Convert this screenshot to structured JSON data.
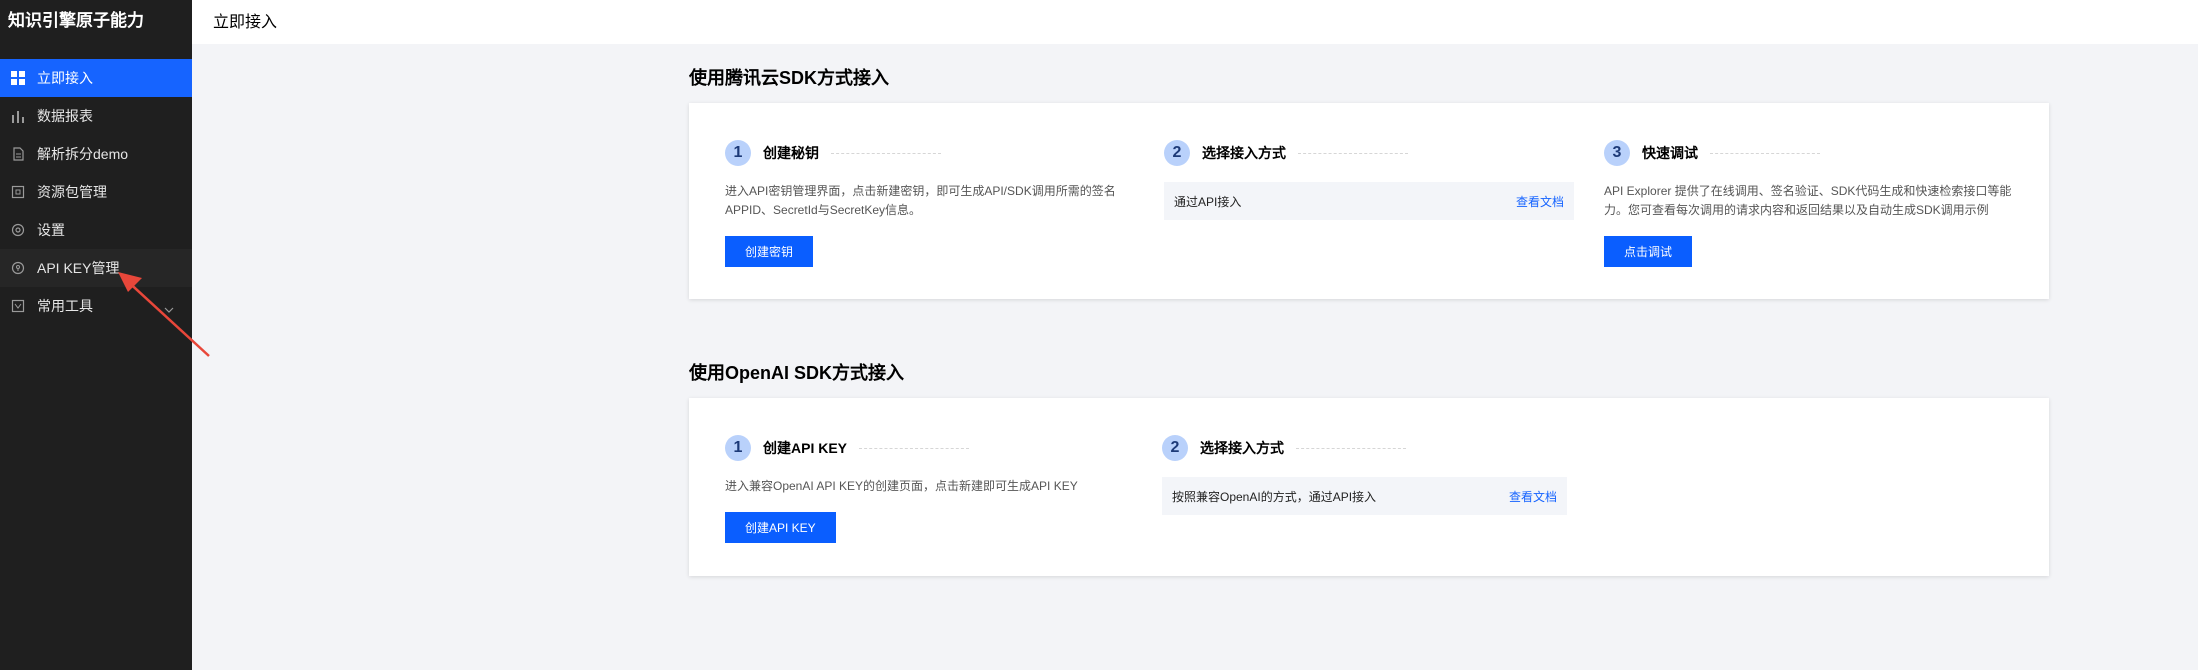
{
  "sidebar": {
    "title": "知识引擎原子能力",
    "items": [
      {
        "label": "立即接入",
        "icon": "grid-icon"
      },
      {
        "label": "数据报表",
        "icon": "bar-chart-icon"
      },
      {
        "label": "解析拆分demo",
        "icon": "document-icon"
      },
      {
        "label": "资源包管理",
        "icon": "package-icon"
      },
      {
        "label": "设置",
        "icon": "settings-icon"
      },
      {
        "label": "API KEY管理",
        "icon": "key-circle-icon"
      },
      {
        "label": "常用工具",
        "icon": "tools-icon"
      }
    ]
  },
  "header": {
    "title": "立即接入"
  },
  "tencent": {
    "title": "使用腾讯云SDK方式接入",
    "step1": {
      "num": "1",
      "title": "创建秘钥",
      "desc": "进入API密钥管理界面，点击新建密钥，即可生成API/SDK调用所需的签名APPID、SecretId与SecretKey信息。",
      "button": "创建密钥"
    },
    "step2": {
      "num": "2",
      "title": "选择接入方式",
      "box_text": "通过API接入",
      "link": "查看文档"
    },
    "step3": {
      "num": "3",
      "title": "快速调试",
      "desc": "API Explorer 提供了在线调用、签名验证、SDK代码生成和快速检索接口等能力。您可查看每次调用的请求内容和返回结果以及自动生成SDK调用示例",
      "button": "点击调试"
    }
  },
  "openai": {
    "title": "使用OpenAI SDK方式接入",
    "step1": {
      "num": "1",
      "title": "创建API KEY",
      "desc": "进入兼容OpenAI API KEY的创建页面，点击新建即可生成API KEY",
      "button": "创建API KEY"
    },
    "step2": {
      "num": "2",
      "title": "选择接入方式",
      "box_text": "按照兼容OpenAI的方式，通过API接入",
      "link": "查看文档"
    }
  },
  "colors": {
    "accent": "#1664ff",
    "sidebar_bg": "#1f1f1f",
    "annotation_arrow": "#e8473a"
  }
}
